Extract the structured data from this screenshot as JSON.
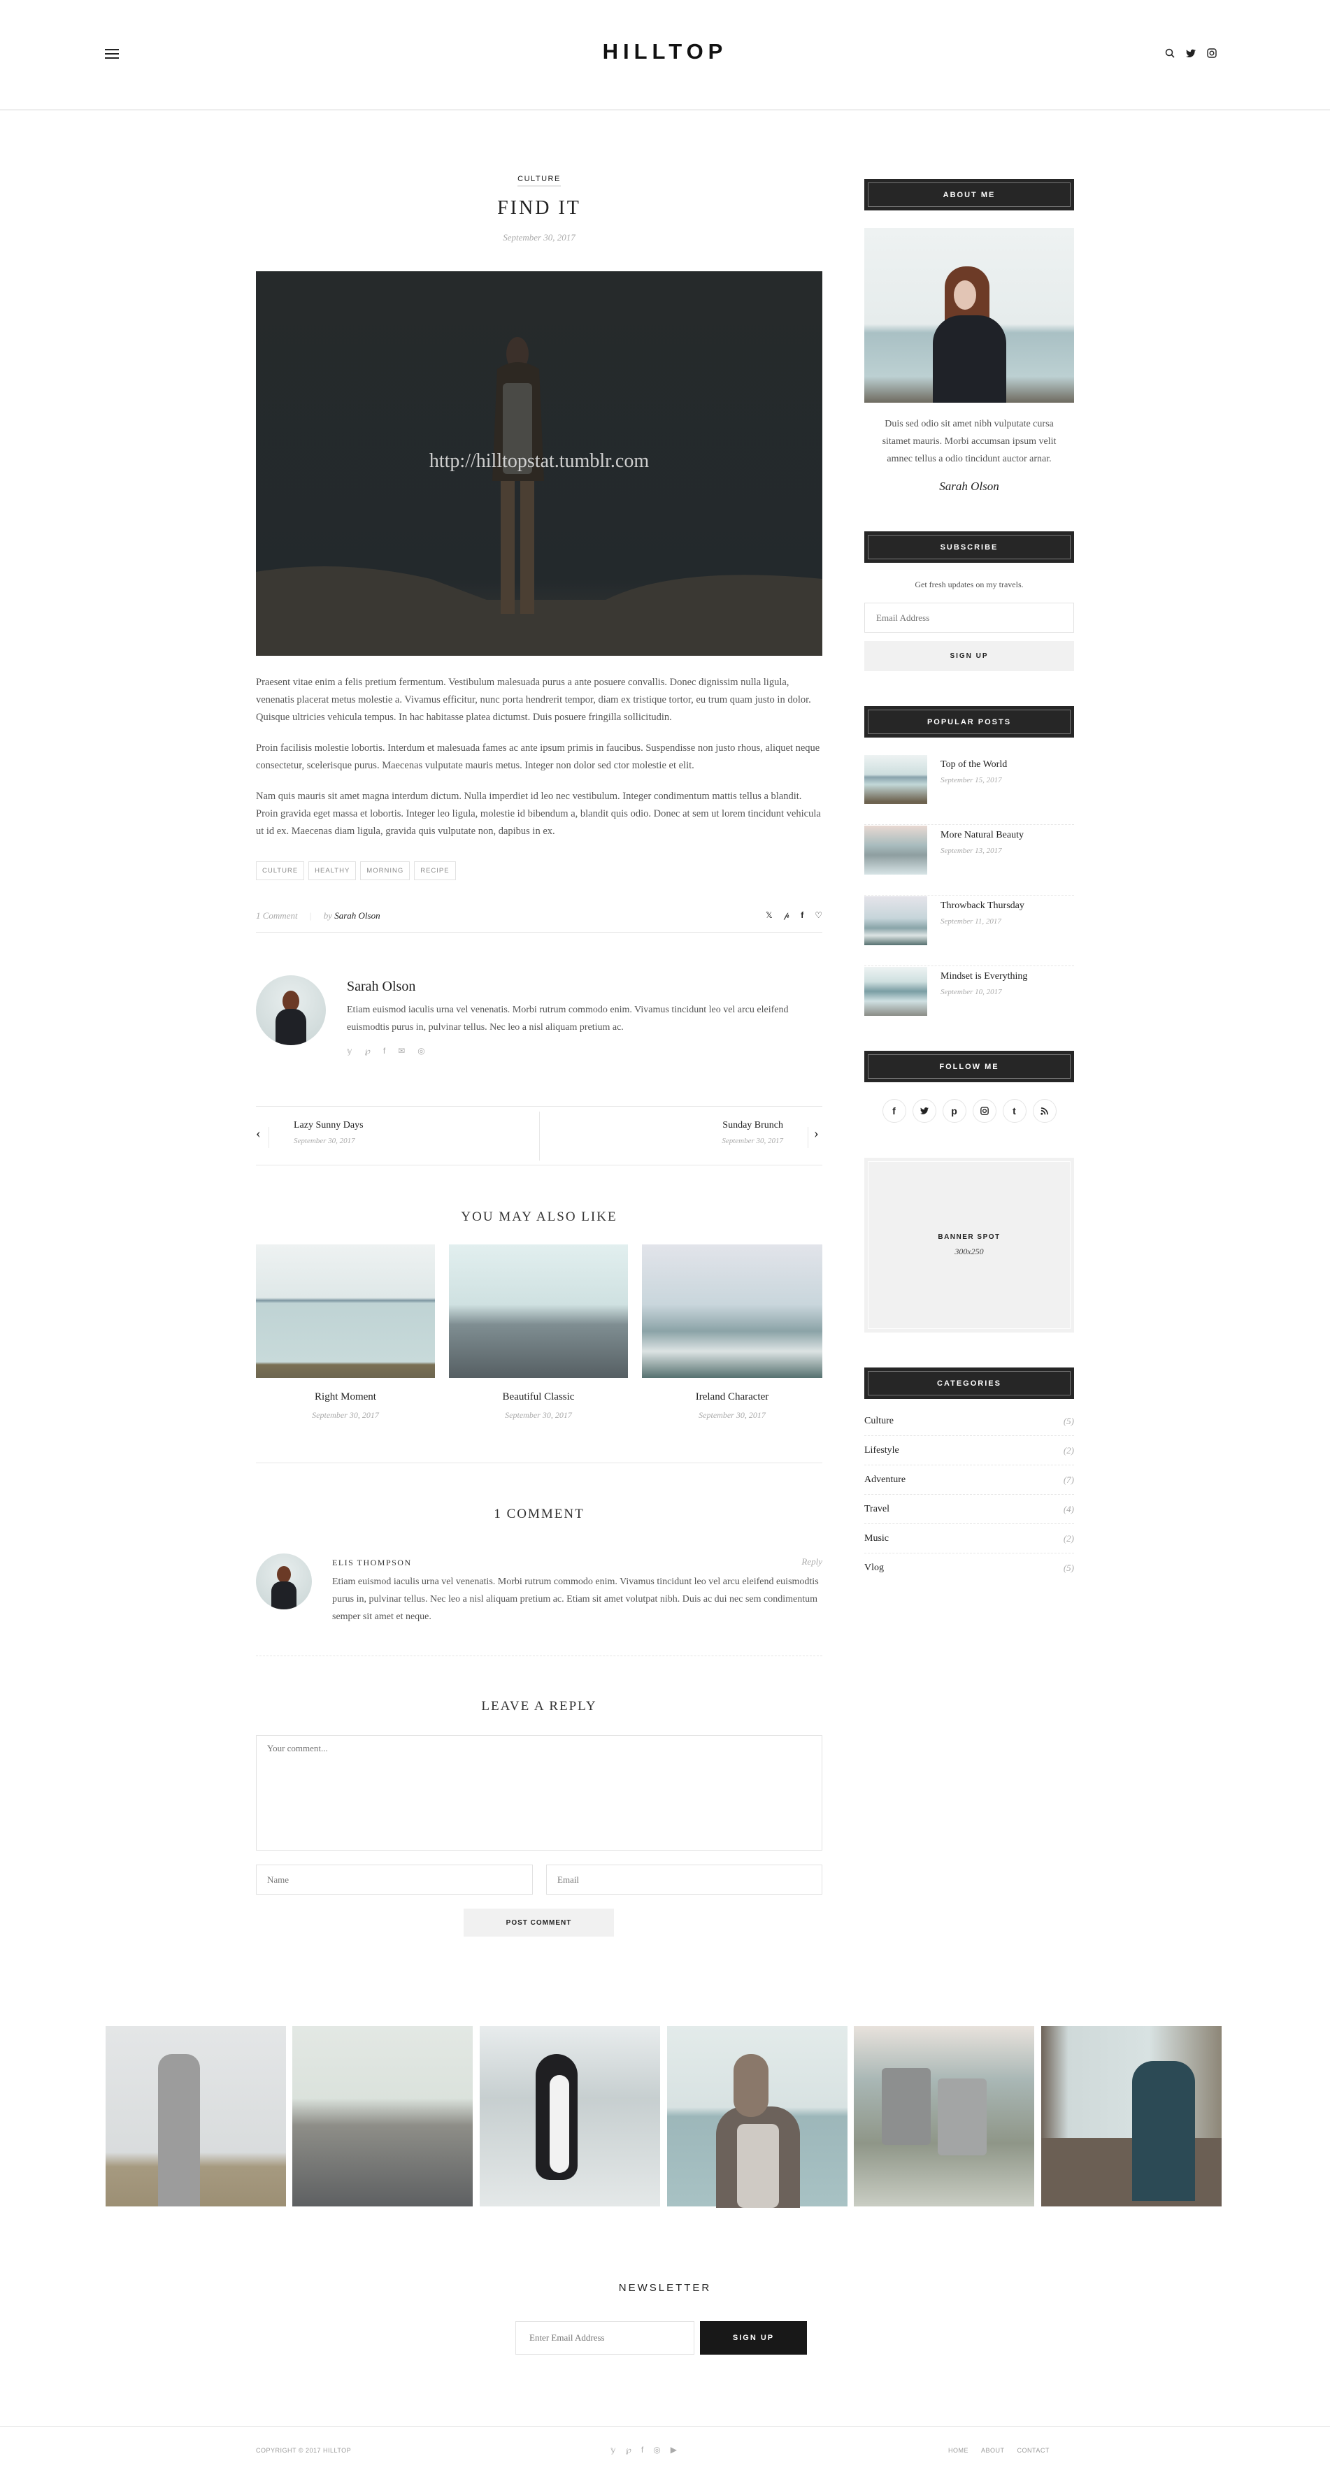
{
  "header": {
    "logo": "HILLTOP",
    "icons": [
      "menu-icon",
      "search-icon",
      "twitter-icon",
      "instagram-icon"
    ]
  },
  "post": {
    "category": "CULTURE",
    "title": "FIND IT",
    "date": "September 30, 2017",
    "hero_overlay_text": "http://hilltopstat.tumblr.com",
    "paragraphs": [
      "Praesent vitae enim a felis pretium fermentum. Vestibulum malesuada purus a ante posuere convallis. Donec dignissim nulla ligula, venenatis placerat metus molestie a. Vivamus efficitur, nunc porta hendrerit tempor, diam ex tristique tortor, eu trum quam justo in dolor. Quisque ultricies vehicula tempus. In hac habitasse platea dictumst. Duis posuere fringilla sollicitudin.",
      "Proin facilisis molestie lobortis. Interdum et malesuada fames ac ante ipsum primis in faucibus. Suspendisse non justo rhous, aliquet neque consectetur, scelerisque purus. Maecenas vulputate mauris metus. Integer non dolor sed ctor molestie et elit.",
      "Nam quis mauris sit amet magna interdum dictum. Nulla imperdiet id leo nec vestibulum. Integer condimentum mattis tellus a blandit. Proin gravida eget massa et lobortis. Integer leo ligula, molestie id bibendum a, blandit quis odio. Donec at sem ut lorem tincidunt vehicula ut id ex. Maecenas diam ligula, gravida quis vulputate non, dapibus in ex."
    ],
    "tags": [
      "CULTURE",
      "HEALTHY",
      "MORNING",
      "RECIPE"
    ],
    "comment_count_label": "1 Comment",
    "by_label": "by",
    "author": "Sarah Olson",
    "share_icons": [
      "twitter-icon",
      "pinterest-icon",
      "facebook-icon",
      "heart-icon"
    ]
  },
  "author_box": {
    "name": "Sarah Olson",
    "bio": "Etiam euismod iaculis urna vel venenatis. Morbi rutrum commodo enim. Vivamus tincidunt leo vel arcu eleifend euismodtis purus in, pulvinar tellus. Nec leo a nisl aliquam pretium ac.",
    "social_icons": [
      "twitter-icon",
      "pinterest-icon",
      "facebook-icon",
      "email-icon",
      "instagram-icon"
    ]
  },
  "post_nav": {
    "prev": {
      "title": "Lazy Sunny Days",
      "date": "September 30, 2017"
    },
    "next": {
      "title": "Sunday Brunch",
      "date": "September 30, 2017"
    }
  },
  "related": {
    "title": "YOU MAY ALSO LIKE",
    "items": [
      {
        "title": "Right Moment",
        "date": "September 30, 2017"
      },
      {
        "title": "Beautiful Classic",
        "date": "September 30, 2017"
      },
      {
        "title": "Ireland Character",
        "date": "September 30, 2017"
      }
    ]
  },
  "comments": {
    "title": "1 COMMENT",
    "items": [
      {
        "author": "ELIS THOMPSON",
        "reply_label": "Reply",
        "text": "Etiam euismod iaculis urna vel venenatis. Morbi rutrum commodo enim. Vivamus tincidunt leo vel arcu eleifend euismodtis purus in, pulvinar tellus. Nec leo a nisl aliquam pretium ac. Etiam sit amet volutpat nibh. Duis ac dui nec sem condimentum semper sit amet et neque."
      }
    ]
  },
  "reply_form": {
    "title": "LEAVE A REPLY",
    "comment_placeholder": "Your comment...",
    "name_placeholder": "Name",
    "email_placeholder": "Email",
    "submit_label": "POST COMMENT"
  },
  "sidebar": {
    "about": {
      "title": "ABOUT ME",
      "text": "Duis sed odio sit amet nibh vulputate cursa sitamet mauris. Morbi accumsan ipsum velit amnec tellus a odio tincidunt auctor arnar.",
      "signature": "Sarah Olson"
    },
    "subscribe": {
      "title": "SUBSCRIBE",
      "text": "Get fresh updates on my travels.",
      "email_placeholder": "Email Address",
      "button_label": "SIGN UP"
    },
    "popular": {
      "title": "POPULAR POSTS",
      "items": [
        {
          "title": "Top of the World",
          "date": "September 15, 2017"
        },
        {
          "title": "More Natural Beauty",
          "date": "September 13, 2017"
        },
        {
          "title": "Throwback Thursday",
          "date": "September 11, 2017"
        },
        {
          "title": "Mindset is Everything",
          "date": "September 10, 2017"
        }
      ]
    },
    "follow": {
      "title": "FOLLOW ME",
      "icons": [
        "facebook-icon",
        "twitter-icon",
        "pinterest-icon",
        "instagram-icon",
        "tumblr-icon",
        "rss-icon"
      ]
    },
    "banner": {
      "label": "BANNER SPOT",
      "size": "300x250"
    },
    "categories": {
      "title": "CATEGORIES",
      "items": [
        {
          "name": "Culture",
          "count": "(5)"
        },
        {
          "name": "Lifestyle",
          "count": "(2)"
        },
        {
          "name": "Adventure",
          "count": "(7)"
        },
        {
          "name": "Travel",
          "count": "(4)"
        },
        {
          "name": "Music",
          "count": "(2)"
        },
        {
          "name": "Vlog",
          "count": "(5)"
        }
      ]
    }
  },
  "instagram_strip": [
    "woman-in-coat",
    "compass-on-pebbles",
    "penguin",
    "hiker-backpack",
    "two-mugs",
    "woman-drinking-tea"
  ],
  "newsletter": {
    "title": "NEWSLETTER",
    "placeholder": "Enter Email Address",
    "button_label": "SIGN UP"
  },
  "footer": {
    "copyright": "COPYRIGHT © 2017 HILLTOP",
    "social_icons": [
      "twitter-icon",
      "pinterest-icon",
      "facebook-icon",
      "instagram-icon",
      "youtube-icon"
    ],
    "links": [
      "HOME",
      "ABOUT",
      "CONTACT"
    ]
  }
}
